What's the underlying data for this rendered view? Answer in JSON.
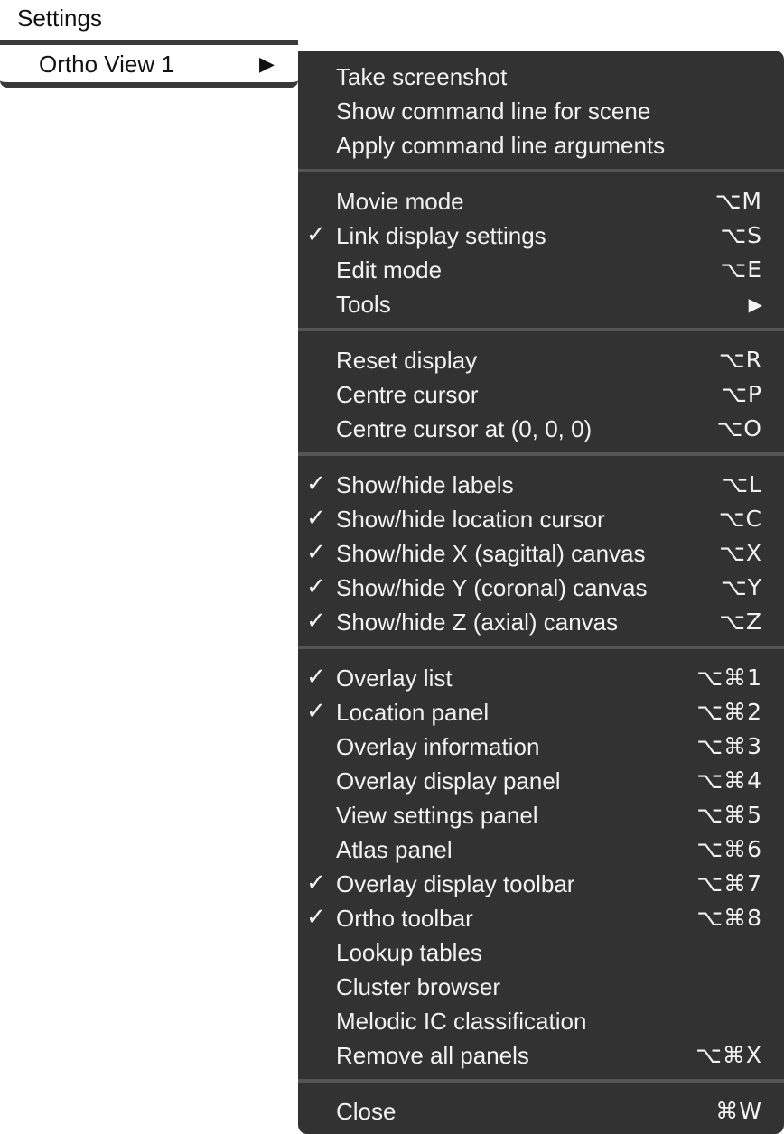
{
  "menubar": {
    "title": "Settings"
  },
  "parent_menu": {
    "item_label": "Ortho View 1",
    "arrow": "▶"
  },
  "submenu": {
    "check_glyph": "✓",
    "submenu_arrow": "▶",
    "items": [
      {
        "label": "Take screenshot",
        "checked": false,
        "shortcut": ""
      },
      {
        "label": "Show command line for scene",
        "checked": false,
        "shortcut": ""
      },
      {
        "label": "Apply command line arguments",
        "checked": false,
        "shortcut": ""
      },
      {
        "label": "Movie mode",
        "checked": false,
        "shortcut": "⌥M"
      },
      {
        "label": "Link display settings",
        "checked": true,
        "shortcut": "⌥S"
      },
      {
        "label": "Edit mode",
        "checked": false,
        "shortcut": "⌥E"
      },
      {
        "label": "Tools",
        "checked": false,
        "shortcut": "",
        "has_submenu": true
      },
      {
        "label": "Reset display",
        "checked": false,
        "shortcut": "⌥R"
      },
      {
        "label": "Centre cursor",
        "checked": false,
        "shortcut": "⌥P"
      },
      {
        "label": "Centre cursor at (0, 0, 0)",
        "checked": false,
        "shortcut": "⌥O"
      },
      {
        "label": "Show/hide labels",
        "checked": true,
        "shortcut": "⌥L"
      },
      {
        "label": "Show/hide location cursor",
        "checked": true,
        "shortcut": "⌥C"
      },
      {
        "label": "Show/hide X (sagittal) canvas",
        "checked": true,
        "shortcut": "⌥X"
      },
      {
        "label": "Show/hide Y (coronal) canvas",
        "checked": true,
        "shortcut": "⌥Y"
      },
      {
        "label": "Show/hide Z (axial) canvas",
        "checked": true,
        "shortcut": "⌥Z"
      },
      {
        "label": "Overlay list",
        "checked": true,
        "shortcut": "⌥⌘1"
      },
      {
        "label": "Location panel",
        "checked": true,
        "shortcut": "⌥⌘2"
      },
      {
        "label": "Overlay information",
        "checked": false,
        "shortcut": "⌥⌘3"
      },
      {
        "label": "Overlay display panel",
        "checked": false,
        "shortcut": "⌥⌘4"
      },
      {
        "label": "View settings panel",
        "checked": false,
        "shortcut": "⌥⌘5"
      },
      {
        "label": "Atlas panel",
        "checked": false,
        "shortcut": "⌥⌘6"
      },
      {
        "label": "Overlay display toolbar",
        "checked": true,
        "shortcut": "⌥⌘7"
      },
      {
        "label": "Ortho toolbar",
        "checked": true,
        "shortcut": "⌥⌘8"
      },
      {
        "label": "Lookup tables",
        "checked": false,
        "shortcut": ""
      },
      {
        "label": "Cluster browser",
        "checked": false,
        "shortcut": ""
      },
      {
        "label": "Melodic IC classification",
        "checked": false,
        "shortcut": ""
      },
      {
        "label": "Remove all panels",
        "checked": false,
        "shortcut": "⌥⌘X"
      },
      {
        "label": "Close",
        "checked": false,
        "shortcut": "⌘W"
      }
    ]
  },
  "colors": {
    "menu_background": "#323232",
    "menu_text": "#f2f2f2",
    "separator": "#555555"
  }
}
